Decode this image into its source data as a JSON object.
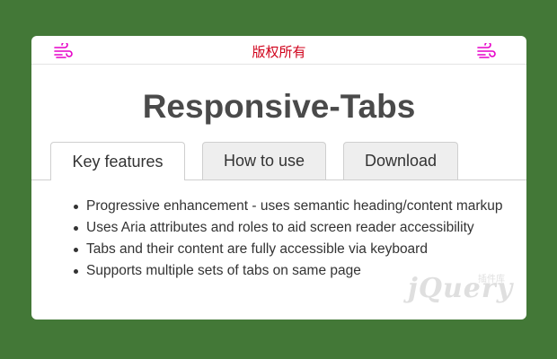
{
  "banner": {
    "text": "版权所有",
    "color": "#d0021b",
    "icon_left": "wind-icon",
    "icon_right": "wind-icon",
    "icon_color": "#e600c8"
  },
  "page": {
    "title": "Responsive-Tabs"
  },
  "tabs": [
    {
      "label": "Key features",
      "active": true
    },
    {
      "label": "How to use",
      "active": false
    },
    {
      "label": "Download",
      "active": false
    }
  ],
  "features": [
    "Progressive enhancement - uses semantic heading/content markup",
    "Uses Aria attributes and roles to aid screen reader accessibility",
    "Tabs and their content are fully accessible via keyboard",
    "Supports multiple sets of tabs on same page"
  ],
  "watermark": {
    "text": "jQuery",
    "sub_text": "插件库"
  },
  "colors": {
    "background": "#437837",
    "card": "#ffffff",
    "title": "#4a4a4a",
    "inactive_tab": "#eeeeee"
  }
}
